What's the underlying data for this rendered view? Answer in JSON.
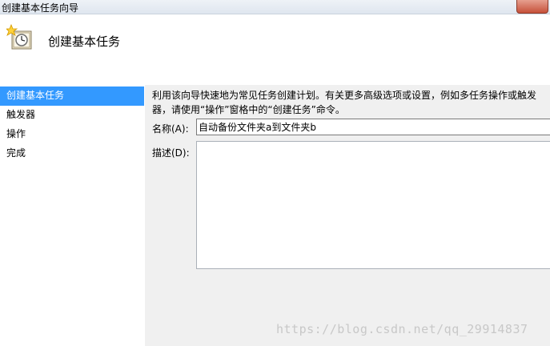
{
  "window": {
    "title": "创建基本任务向导"
  },
  "header": {
    "title": "创建基本任务",
    "icon": "task-clock-icon"
  },
  "sidebar": {
    "items": [
      {
        "label": "创建基本任务",
        "active": true
      },
      {
        "label": "触发器",
        "active": false
      },
      {
        "label": "操作",
        "active": false
      },
      {
        "label": "完成",
        "active": false
      }
    ]
  },
  "main": {
    "description": "利用该向导快速地为常见任务创建计划。有关更多高级选项或设置，例如多任务操作或触发器，请使用“操作”窗格中的“创建任务”命令。",
    "name_label": "名称(A):",
    "name_value": "自动备份文件夹a到文件夹b",
    "description_label": "描述(D):",
    "description_value": ""
  },
  "watermark": "https://blog.csdn.net/qq_29914837",
  "colors": {
    "selection": "#3399ff",
    "content_bg": "#f0f0f0"
  }
}
